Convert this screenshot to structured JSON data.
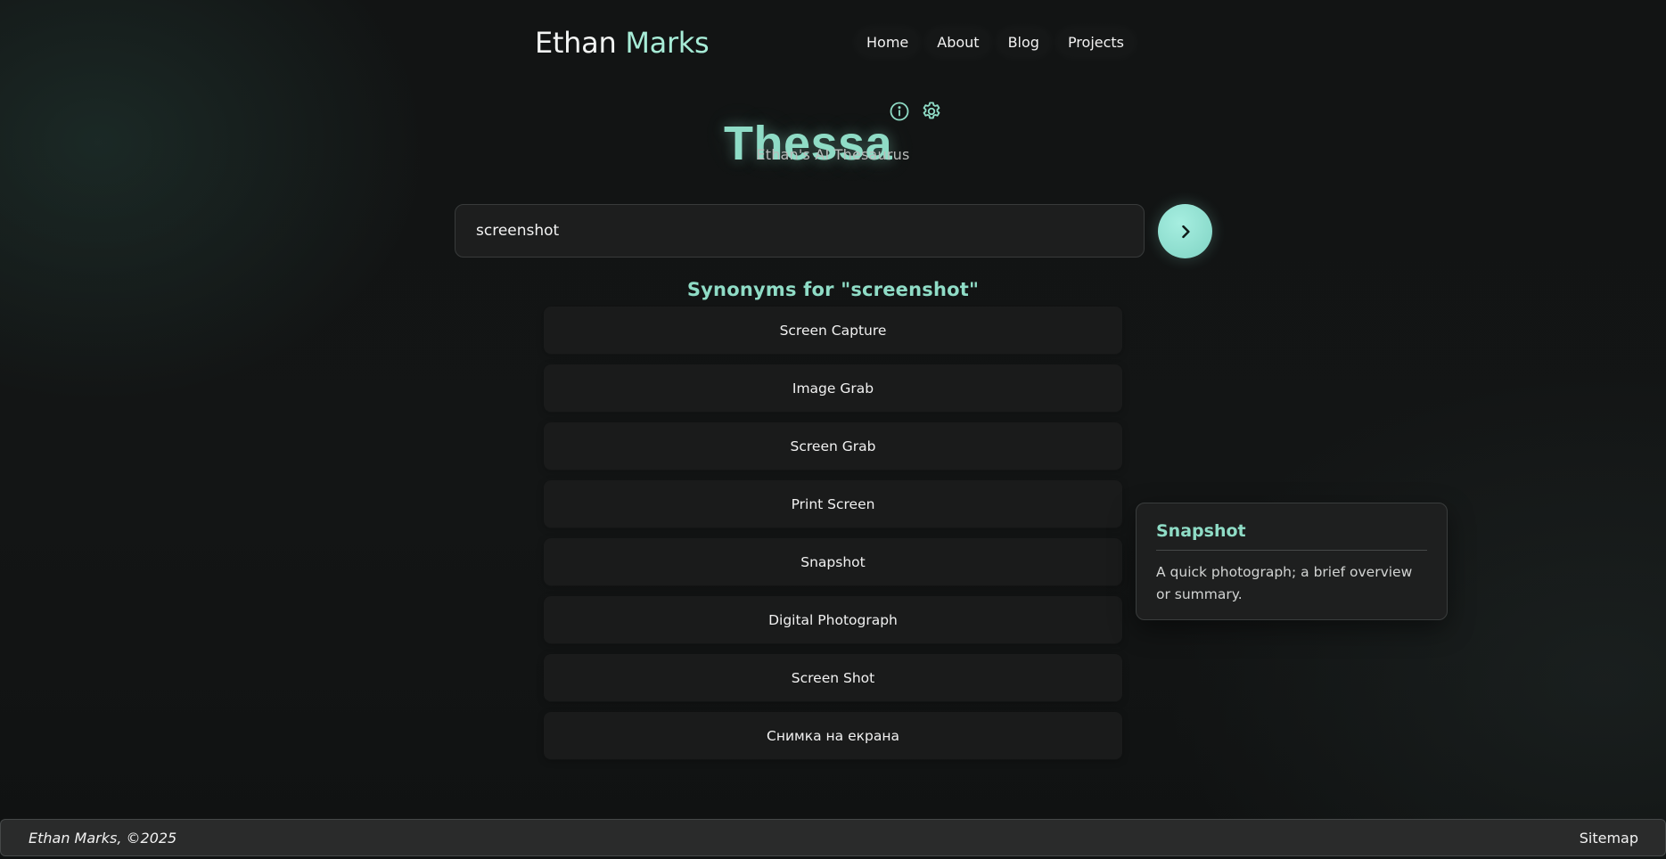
{
  "header": {
    "brand_first": "Ethan",
    "brand_last": "Marks",
    "nav": [
      {
        "label": "Home"
      },
      {
        "label": "About"
      },
      {
        "label": "Blog"
      },
      {
        "label": "Projects"
      }
    ]
  },
  "hero": {
    "title": "Thessa",
    "subtitle": "Ethan's AI Thesaurus",
    "info_icon": "info-circle-icon",
    "settings_icon": "gear-icon"
  },
  "search": {
    "value": "screenshot",
    "submit_icon": "chevron-right-icon"
  },
  "results": {
    "heading": "Synonyms for \"screenshot\"",
    "synonyms": [
      {
        "label": "Screen Capture"
      },
      {
        "label": "Image Grab"
      },
      {
        "label": "Screen Grab"
      },
      {
        "label": "Print Screen"
      },
      {
        "label": "Snapshot"
      },
      {
        "label": "Digital Photograph"
      },
      {
        "label": "Screen Shot"
      },
      {
        "label": "Снимка на екрана"
      }
    ]
  },
  "definition": {
    "title": "Snapshot",
    "text": "A quick photograph; a brief overview or summary."
  },
  "footer": {
    "copyright": "Ethan Marks, ©2025",
    "sitemap_label": "Sitemap"
  },
  "colors": {
    "accent": "#8fdcc6",
    "background": "#131515",
    "card": "#1a1b1b"
  }
}
